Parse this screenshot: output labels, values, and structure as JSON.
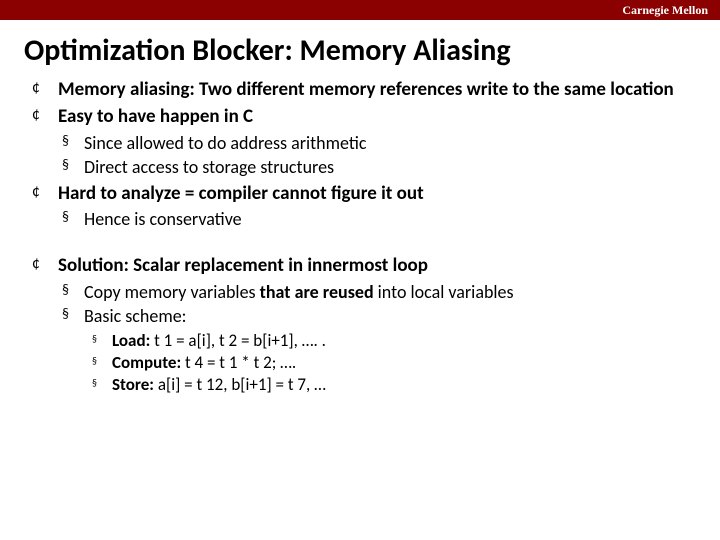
{
  "header": {
    "brand": "Carnegie Mellon"
  },
  "title": "Optimization Blocker: Memory Aliasing",
  "bullets": {
    "0": "Memory aliasing: Two different memory references write to the same location",
    "1": "Easy to have happen in C",
    "2": "Since allowed to do address arithmetic",
    "3": "Direct access to storage structures",
    "4": "Hard to analyze = compiler cannot figure it out",
    "5": "Hence is conservative",
    "6": "Solution: Scalar replacement in innermost loop",
    "7a": "Copy memory variables ",
    "7b": "that are reused",
    "7c": " into local variables",
    "8": "Basic scheme:",
    "9a": "Load:",
    "9b": " t 1 = a[i], t 2 = b[i+1], …. .",
    "10a": "Compute:",
    "10b": " t 4 = t 1 * t 2; ….",
    "11a": "Store:",
    "11b": " a[i] = t 12, b[i+1] = t 7, …"
  }
}
